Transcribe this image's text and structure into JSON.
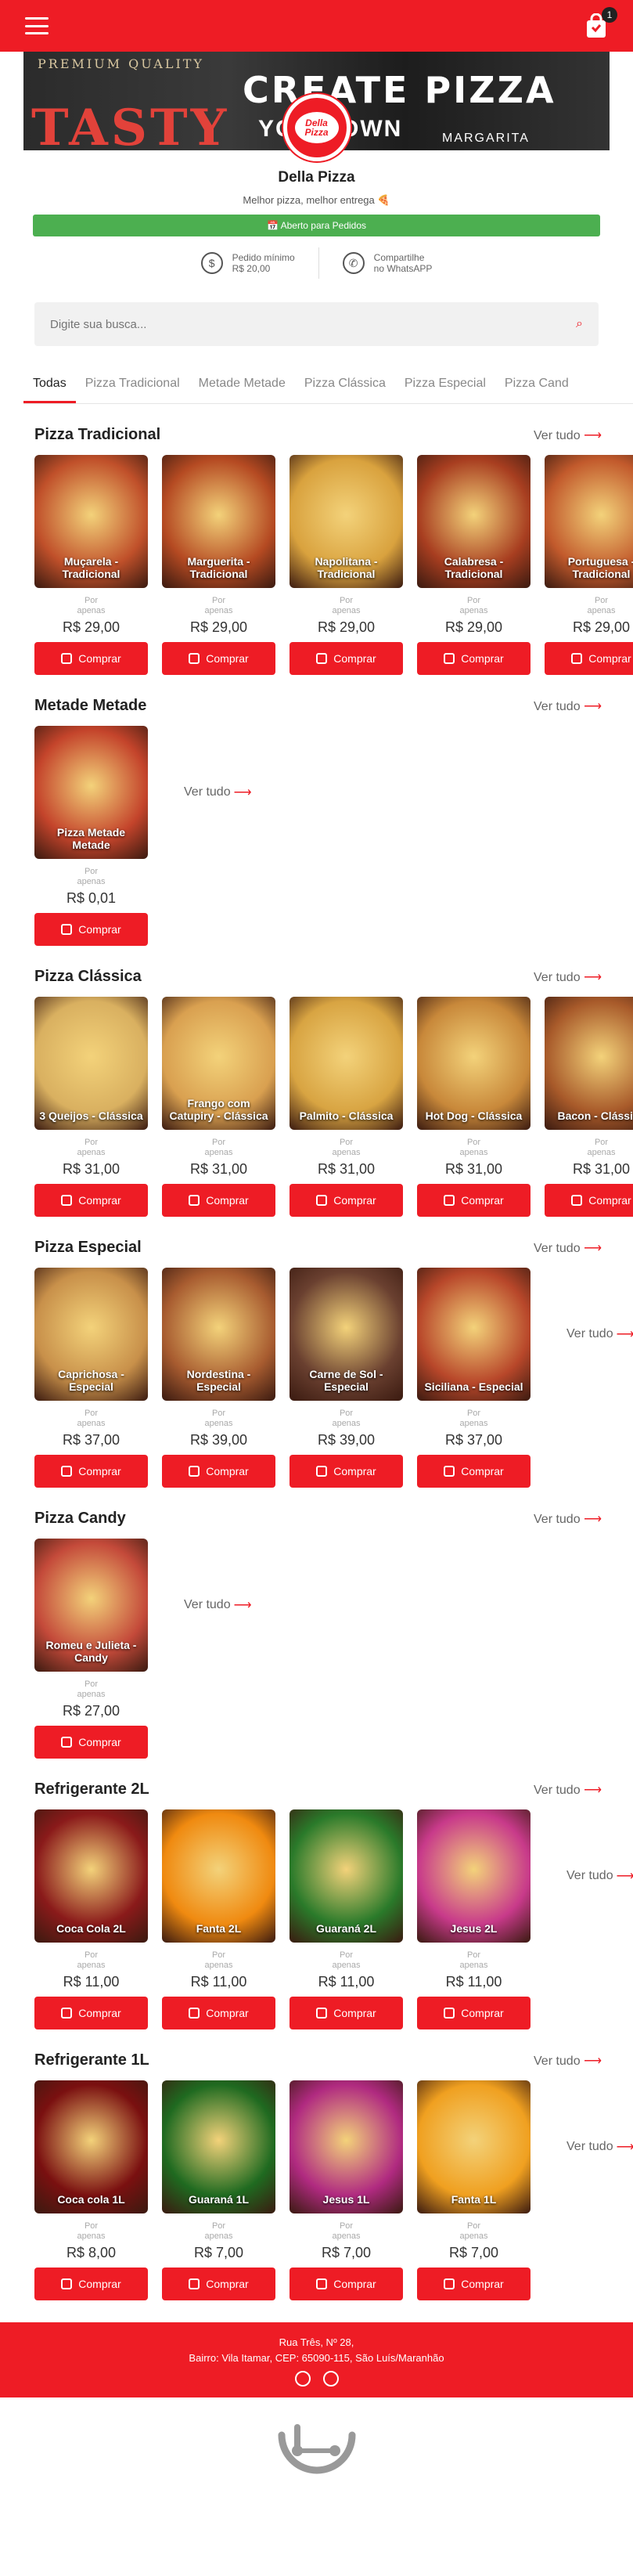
{
  "header": {
    "cart_count": "1"
  },
  "banner": {
    "line1": "PREMIUM QUALITY",
    "big_left": "TASTY",
    "create": "CREATE PIZZA",
    "your": "YOUR OWN",
    "margarita": "MARGARITA"
  },
  "store": {
    "logo_text1": "Della",
    "logo_text2": "Pizza",
    "name": "Della Pizza",
    "tagline": "Melhor pizza, melhor entrega 🍕",
    "status": "📅 Aberto para Pedidos",
    "min_order_label": "Pedido mínimo",
    "min_order_value": "R$ 20,00",
    "share_label": "Compartilhe",
    "share_sub": "no WhatsAPP"
  },
  "search": {
    "placeholder": "Digite sua busca..."
  },
  "tabs": [
    "Todas",
    "Pizza Tradicional",
    "Metade Metade",
    "Pizza Clássica",
    "Pizza Especial",
    "Pizza Cand"
  ],
  "labels": {
    "see_all": "Ver tudo",
    "por": "Por",
    "apenas": "apenas",
    "buy": "Comprar"
  },
  "sections": [
    {
      "title": "Pizza Tradicional",
      "see_all_inline": false,
      "items": [
        {
          "name": "Muçarela - Tradicional",
          "price": "R$ 29,00",
          "color": "#c0502a"
        },
        {
          "name": "Marguerita - Tradicional",
          "price": "R$ 29,00",
          "color": "#b54a22"
        },
        {
          "name": "Napolitana - Tradicional",
          "price": "R$ 29,00",
          "color": "#d9a23e"
        },
        {
          "name": "Calabresa - Tradicional",
          "price": "R$ 29,00",
          "color": "#a83e20"
        },
        {
          "name": "Portuguesa - Tradicional",
          "price": "R$ 29,00",
          "color": "#c25a2c"
        }
      ]
    },
    {
      "title": "Metade Metade",
      "see_all_inline": true,
      "items": [
        {
          "name": "Pizza Metade Metade",
          "price": "R$ 0,01",
          "color": "#c4442b"
        }
      ]
    },
    {
      "title": "Pizza Clássica",
      "see_all_inline": false,
      "items": [
        {
          "name": "3 Queijos - Clássica",
          "price": "R$ 31,00",
          "color": "#d9b060"
        },
        {
          "name": "Frango com Catupiry - Clássica",
          "price": "R$ 31,00",
          "color": "#d9a050"
        },
        {
          "name": "Palmito - Clássica",
          "price": "R$ 31,00",
          "color": "#d8a442"
        },
        {
          "name": "Hot Dog - Clássica",
          "price": "R$ 31,00",
          "color": "#c8883a"
        },
        {
          "name": "Bacon - Clássica",
          "price": "R$ 31,00",
          "color": "#a85a2a"
        }
      ]
    },
    {
      "title": "Pizza Especial",
      "see_all_inline": true,
      "items": [
        {
          "name": "Caprichosa - Especial",
          "price": "R$ 37,00",
          "color": "#c8904a"
        },
        {
          "name": "Nordestina - Especial",
          "price": "R$ 39,00",
          "color": "#a85c30"
        },
        {
          "name": "Carne de Sol - Especial",
          "price": "R$ 39,00",
          "color": "#6a4030"
        },
        {
          "name": "Siciliana - Especial",
          "price": "R$ 37,00",
          "color": "#b8472a"
        }
      ]
    },
    {
      "title": "Pizza Candy",
      "see_all_inline": true,
      "items": [
        {
          "name": "Romeu e Julieta - Candy",
          "price": "R$ 27,00",
          "color": "#c44a3a"
        }
      ]
    },
    {
      "title": "Refrigerante 2L",
      "see_all_inline": true,
      "items": [
        {
          "name": "Coca Cola 2L",
          "price": "R$ 11,00",
          "color": "#8a1a1a"
        },
        {
          "name": "Fanta 2L",
          "price": "R$ 11,00",
          "color": "#f08a10"
        },
        {
          "name": "Guaraná 2L",
          "price": "R$ 11,00",
          "color": "#2a7a2a"
        },
        {
          "name": "Jesus 2L",
          "price": "R$ 11,00",
          "color": "#c83a8a"
        }
      ]
    },
    {
      "title": "Refrigerante 1L",
      "see_all_inline": true,
      "items": [
        {
          "name": "Coca cola 1L",
          "price": "R$ 8,00",
          "color": "#7a1010"
        },
        {
          "name": "Guaraná 1L",
          "price": "R$ 7,00",
          "color": "#1f6a20"
        },
        {
          "name": "Jesus 1L",
          "price": "R$ 7,00",
          "color": "#b02a80"
        },
        {
          "name": "Fanta 1L",
          "price": "R$ 7,00",
          "color": "#f0a020"
        }
      ]
    }
  ],
  "footer": {
    "line1": "Rua Três, Nº 28,",
    "line2": "Bairro: Vila Itamar, CEP: 65090-115, São Luís/Maranhão"
  }
}
